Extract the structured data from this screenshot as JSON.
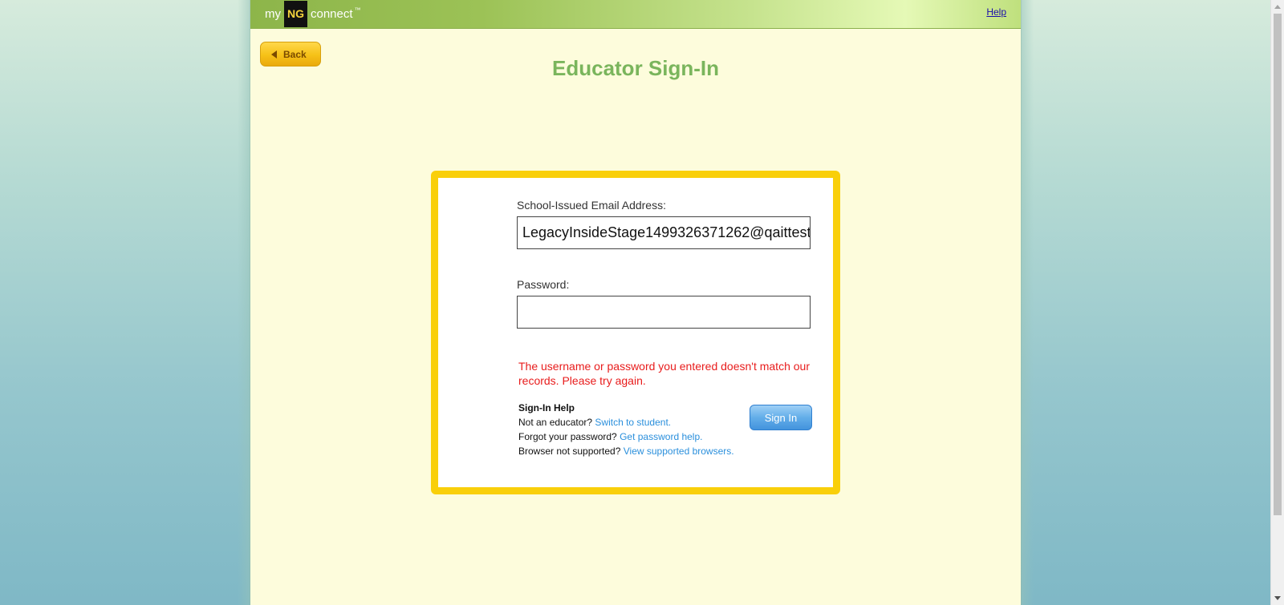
{
  "header": {
    "logo": {
      "my": "my",
      "ng": "NG",
      "connect": "connect",
      "tm": "™"
    },
    "help_label": "Help"
  },
  "back_button": {
    "label": "Back"
  },
  "page_title": "Educator Sign-In",
  "form": {
    "email_label": "School-Issued Email Address:",
    "email_value": "LegacyInsideStage1499326371262@qaittest",
    "password_label": "Password:",
    "password_value": "",
    "error_message": "The username or password you entered doesn't match our records. Please try again.",
    "signin_label": "Sign In"
  },
  "sign_in_help": {
    "heading": "Sign-In Help",
    "lines": [
      {
        "text": "Not an educator?",
        "link": "Switch to student."
      },
      {
        "text": "Forgot your password?",
        "link": "Get password help."
      },
      {
        "text": "Browser not supported?",
        "link": "View supported browsers."
      }
    ]
  },
  "colors": {
    "title_green": "#7ab55c",
    "card_border": "#f9cf0a",
    "error_red": "#e81c1c",
    "link_blue": "#2a8fdc",
    "page_bg": "#fdfcdc"
  }
}
